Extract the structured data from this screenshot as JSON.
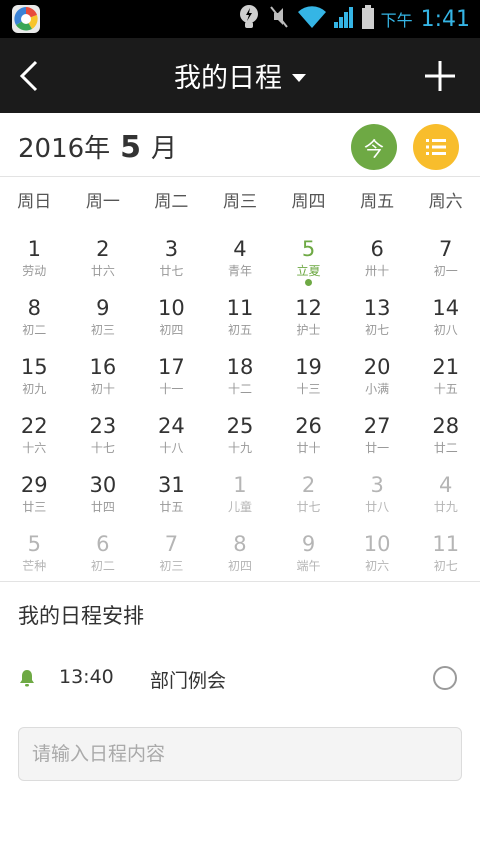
{
  "status_bar": {
    "ampm": "下午",
    "time": "1:41"
  },
  "title_bar": {
    "title": "我的日程"
  },
  "month_header": {
    "year_label": "2016年",
    "month": "5",
    "month_suffix": "月",
    "today_button": "今"
  },
  "weekdays": [
    "周日",
    "周一",
    "周二",
    "周三",
    "周四",
    "周五",
    "周六"
  ],
  "calendar": {
    "days": [
      {
        "num": "1",
        "lunar": "劳动"
      },
      {
        "num": "2",
        "lunar": "廿六"
      },
      {
        "num": "3",
        "lunar": "廿七"
      },
      {
        "num": "4",
        "lunar": "青年"
      },
      {
        "num": "5",
        "lunar": "立夏",
        "today": true,
        "has_event": true
      },
      {
        "num": "6",
        "lunar": "卅十"
      },
      {
        "num": "7",
        "lunar": "初一"
      },
      {
        "num": "8",
        "lunar": "初二"
      },
      {
        "num": "9",
        "lunar": "初三"
      },
      {
        "num": "10",
        "lunar": "初四"
      },
      {
        "num": "11",
        "lunar": "初五"
      },
      {
        "num": "12",
        "lunar": "护士"
      },
      {
        "num": "13",
        "lunar": "初七"
      },
      {
        "num": "14",
        "lunar": "初八"
      },
      {
        "num": "15",
        "lunar": "初九"
      },
      {
        "num": "16",
        "lunar": "初十"
      },
      {
        "num": "17",
        "lunar": "十一"
      },
      {
        "num": "18",
        "lunar": "十二"
      },
      {
        "num": "19",
        "lunar": "十三"
      },
      {
        "num": "20",
        "lunar": "小满"
      },
      {
        "num": "21",
        "lunar": "十五"
      },
      {
        "num": "22",
        "lunar": "十六"
      },
      {
        "num": "23",
        "lunar": "十七"
      },
      {
        "num": "24",
        "lunar": "十八"
      },
      {
        "num": "25",
        "lunar": "十九"
      },
      {
        "num": "26",
        "lunar": "廿十"
      },
      {
        "num": "27",
        "lunar": "廿一"
      },
      {
        "num": "28",
        "lunar": "廿二"
      },
      {
        "num": "29",
        "lunar": "廿三"
      },
      {
        "num": "30",
        "lunar": "廿四"
      },
      {
        "num": "31",
        "lunar": "廿五"
      },
      {
        "num": "1",
        "lunar": "儿童",
        "other": true
      },
      {
        "num": "2",
        "lunar": "廿七",
        "other": true
      },
      {
        "num": "3",
        "lunar": "廿八",
        "other": true
      },
      {
        "num": "4",
        "lunar": "廿九",
        "other": true
      },
      {
        "num": "5",
        "lunar": "芒种",
        "other": true
      },
      {
        "num": "6",
        "lunar": "初二",
        "other": true
      },
      {
        "num": "7",
        "lunar": "初三",
        "other": true
      },
      {
        "num": "8",
        "lunar": "初四",
        "other": true
      },
      {
        "num": "9",
        "lunar": "端午",
        "other": true
      },
      {
        "num": "10",
        "lunar": "初六",
        "other": true
      },
      {
        "num": "11",
        "lunar": "初七",
        "other": true
      }
    ]
  },
  "schedule": {
    "section_title": "我的日程安排",
    "event": {
      "time": "13:40",
      "title": "部门例会"
    },
    "input_placeholder": "请输入日程内容"
  },
  "colors": {
    "accent_green": "#6ea944",
    "accent_yellow": "#f8bd2c",
    "titlebar": "#1b1b1b",
    "status_blue": "#35b5e5"
  }
}
